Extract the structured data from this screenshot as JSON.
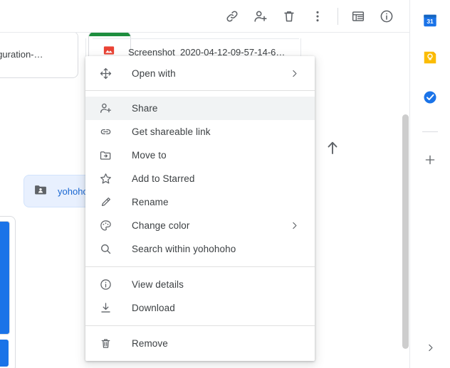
{
  "toolbar": {
    "buttons": [
      {
        "name": "get-link-icon",
        "label": "Get shareable link"
      },
      {
        "name": "add-person-icon",
        "label": "Share"
      },
      {
        "name": "trash-icon",
        "label": "Remove"
      },
      {
        "name": "more-options-icon",
        "label": "More actions"
      }
    ],
    "right_buttons": [
      {
        "name": "list-view-icon",
        "label": "List view"
      },
      {
        "name": "details-info-icon",
        "label": "View details"
      }
    ]
  },
  "content": {
    "cards": [
      {
        "label": "d Configuration-…",
        "accent": "#ffffff"
      },
      {
        "label": "",
        "accent": "#1e8e3e"
      }
    ],
    "file_row": {
      "icon": "image-file-icon",
      "name": "Screenshot_2020-04-12-09-57-14-6…"
    },
    "folder_chip": {
      "icon": "shared-folder-icon",
      "name": "yohoho",
      "text_color": "#1967d2",
      "bg_color": "#e8f0fe"
    }
  },
  "context_menu": {
    "groups": [
      {
        "items": [
          {
            "icon": "open-with-icon",
            "label": "Open with",
            "submenu": true,
            "selected": false
          }
        ]
      },
      {
        "items": [
          {
            "icon": "share-person-add-icon",
            "label": "Share",
            "submenu": false,
            "selected": true
          },
          {
            "icon": "link-icon",
            "label": "Get shareable link",
            "submenu": false,
            "selected": false
          },
          {
            "icon": "move-to-folder-icon",
            "label": "Move to",
            "submenu": false,
            "selected": false
          },
          {
            "icon": "star-icon",
            "label": "Add to Starred",
            "submenu": false,
            "selected": false
          },
          {
            "icon": "pencil-rename-icon",
            "label": "Rename",
            "submenu": false,
            "selected": false
          },
          {
            "icon": "palette-icon",
            "label": "Change color",
            "submenu": true,
            "selected": false
          },
          {
            "icon": "search-icon",
            "label": "Search within yohohoho",
            "submenu": false,
            "selected": false
          }
        ]
      },
      {
        "items": [
          {
            "icon": "info-circle-icon",
            "label": "View details",
            "submenu": false,
            "selected": false
          },
          {
            "icon": "download-icon",
            "label": "Download",
            "submenu": false,
            "selected": false
          }
        ]
      },
      {
        "items": [
          {
            "icon": "trash-icon",
            "label": "Remove",
            "submenu": false,
            "selected": false
          }
        ]
      }
    ]
  },
  "side_panel": {
    "apps": [
      {
        "name": "google-calendar-icon",
        "label": "Calendar",
        "badge": "31",
        "color": "#1a73e8"
      },
      {
        "name": "google-keep-icon",
        "label": "Keep",
        "badge": "",
        "color": "#fbbc04"
      },
      {
        "name": "google-tasks-icon",
        "label": "Tasks",
        "badge": "",
        "color": "#1a73e8"
      }
    ],
    "add_label": "Get add-ons",
    "expand_label": "Show side panel"
  },
  "colors": {
    "accent_blue": "#1a73e8",
    "selected_bg": "#f1f3f4",
    "chip_bg": "#e8f0fe",
    "icon_gray": "#5f6368",
    "green_accent": "#1e8e3e",
    "image_red": "#ea4335"
  }
}
